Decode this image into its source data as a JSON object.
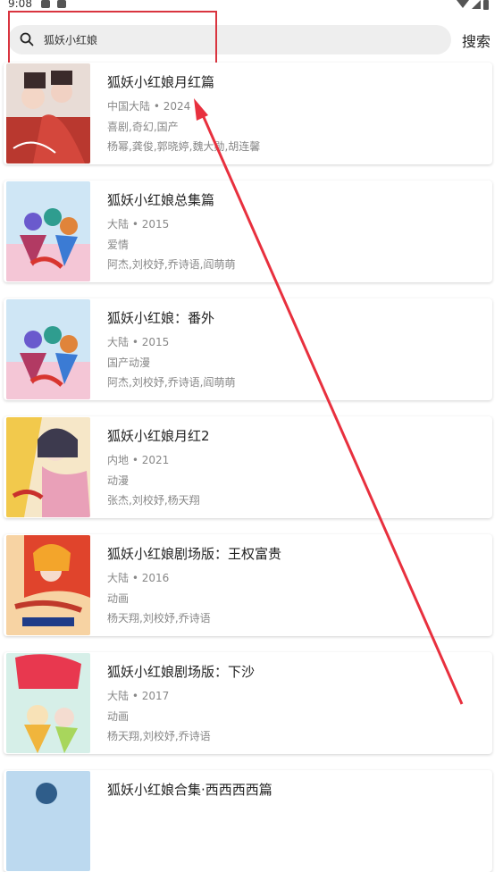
{
  "status_bar": {
    "time": "9:08"
  },
  "search": {
    "value": "狐妖小红娘",
    "button_label": "搜索"
  },
  "results": [
    {
      "title": "狐妖小红娘月红篇",
      "meta": "中国大陆 • 2024",
      "genre": "喜剧,奇幻,国产",
      "cast": "杨幂,龚俊,郭晓婷,魏大勋,胡连馨"
    },
    {
      "title": "狐妖小红娘总集篇",
      "meta": "大陆 • 2015",
      "genre": "爱情",
      "cast": "阿杰,刘校妤,乔诗语,阎萌萌"
    },
    {
      "title": "狐妖小红娘：番外",
      "meta": "大陆 • 2015",
      "genre": "国产动漫",
      "cast": "阿杰,刘校妤,乔诗语,阎萌萌"
    },
    {
      "title": "狐妖小红娘月红2",
      "meta": "内地 • 2021",
      "genre": "动漫",
      "cast": "张杰,刘校妤,杨天翔"
    },
    {
      "title": "狐妖小红娘剧场版：王权富贵",
      "meta": "大陆 • 2016",
      "genre": "动画",
      "cast": "杨天翔,刘校妤,乔诗语"
    },
    {
      "title": "狐妖小红娘剧场版：下沙",
      "meta": "大陆 • 2017",
      "genre": "动画",
      "cast": "杨天翔,刘校妤,乔诗语"
    },
    {
      "title": "狐妖小红娘合集·西西西西篇",
      "meta": "",
      "genre": "",
      "cast": ""
    }
  ],
  "colors": {
    "annotation": "#d9343f",
    "search_bg": "#eeeeee",
    "meta_text": "#888888"
  }
}
